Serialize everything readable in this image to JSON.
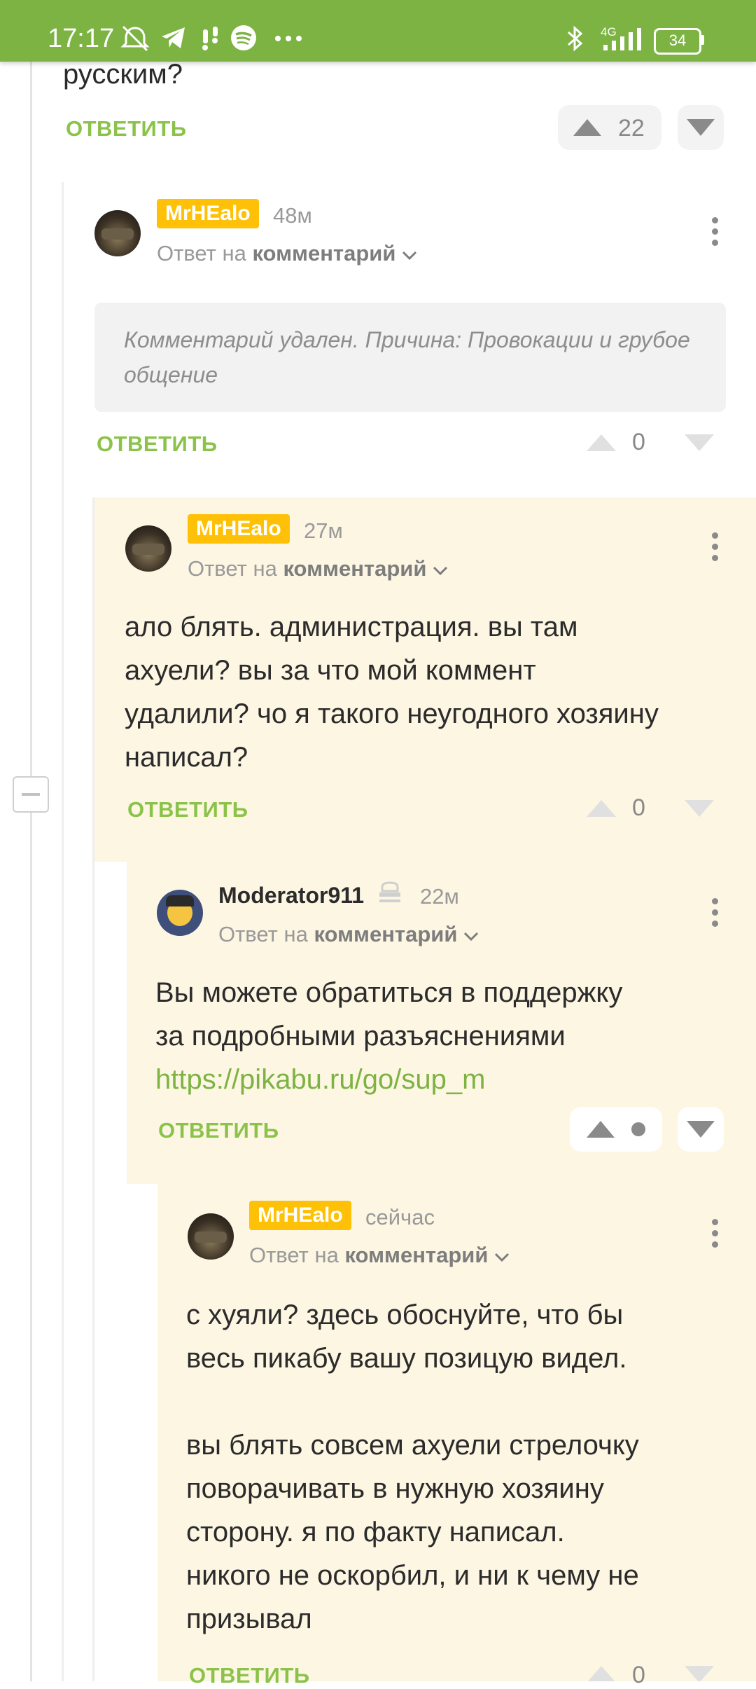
{
  "status_bar": {
    "time": "17:17",
    "network": "4G",
    "battery": "34"
  },
  "top_comment": {
    "text_tail": "русским?",
    "reply_label": "ОТВЕТИТЬ",
    "votes": "22"
  },
  "comments": [
    {
      "username": "MrHEalo",
      "time": "48м",
      "reply_to_prefix": "Ответ на",
      "reply_to_link": "комментарий",
      "deleted_text": "Комментарий удален. Причина: Провокации и грубое общение",
      "reply_label": "ОТВЕТИТЬ",
      "votes": "0"
    },
    {
      "username": "MrHEalo",
      "time": "27м",
      "reply_to_prefix": "Ответ на",
      "reply_to_link": "комментарий",
      "lines": [
        "ало блять. администрация. вы там",
        "ахуели? вы за что мой коммент",
        "удалили? чо я такого неугодного хозяину",
        "написал?"
      ],
      "reply_label": "ОТВЕТИТЬ",
      "votes": "0"
    },
    {
      "username": "Moderator911",
      "time": "22м",
      "reply_to_prefix": "Ответ на",
      "reply_to_link": "комментарий",
      "lines": [
        "Вы можете обратиться в поддержку",
        "за подробными разъяснениями"
      ],
      "link": "https://pikabu.ru/go/sup_m",
      "reply_label": "ОТВЕТИТЬ"
    },
    {
      "username": "MrHEalo",
      "time": "сейчас",
      "reply_to_prefix": "Ответ на",
      "reply_to_link": "комментарий",
      "lines": [
        "с хуяли? здесь обоснуйте, что бы",
        "весь пикабу вашу позицую видел.",
        "",
        "вы блять совсем ахуели стрелочку",
        "поворачивать в нужную хозяину",
        "сторону. я по факту написал.",
        "никого не оскорбил, и ни к чему не",
        "призывал"
      ],
      "reply_label": "ОТВЕТИТЬ",
      "votes": "0"
    }
  ],
  "colors": {
    "accent": "#7cb342",
    "badge": "#ffc107",
    "highlight_bg": "#fdf6e3"
  }
}
